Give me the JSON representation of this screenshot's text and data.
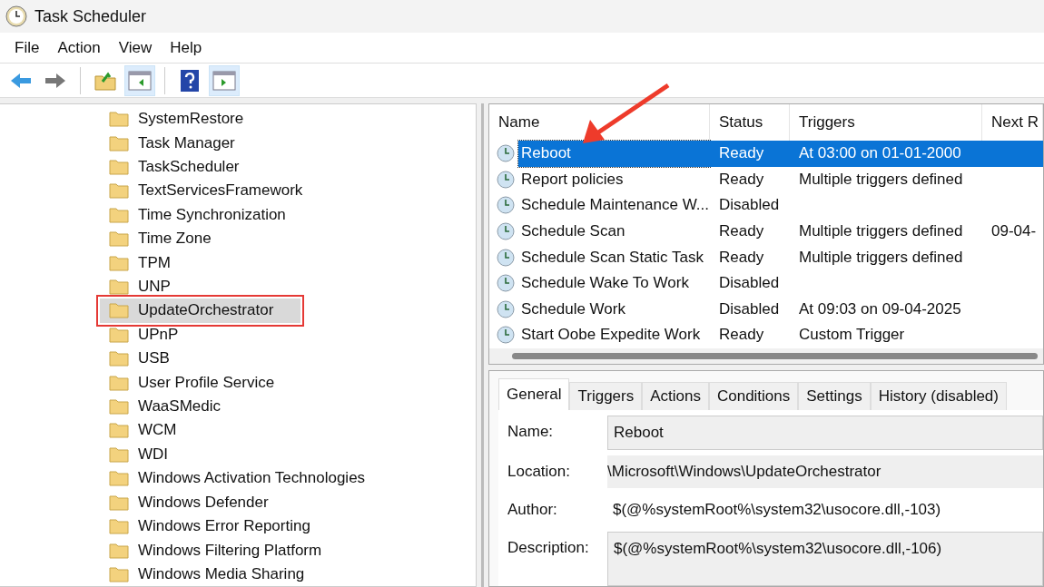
{
  "window": {
    "title": "Task Scheduler"
  },
  "menu": [
    "File",
    "Action",
    "View",
    "Help"
  ],
  "toolbar": [
    {
      "kind": "back",
      "pressed": false
    },
    {
      "kind": "forward",
      "pressed": false
    },
    {
      "kind": "sep"
    },
    {
      "kind": "folder",
      "pressed": false
    },
    {
      "kind": "pane-left",
      "pressed": true
    },
    {
      "kind": "sep"
    },
    {
      "kind": "help",
      "pressed": false
    },
    {
      "kind": "pane-right",
      "pressed": true
    }
  ],
  "tree": [
    {
      "label": "SystemRestore",
      "selected": false,
      "outlined": false
    },
    {
      "label": "Task Manager",
      "selected": false,
      "outlined": false
    },
    {
      "label": "TaskScheduler",
      "selected": false,
      "outlined": false
    },
    {
      "label": "TextServicesFramework",
      "selected": false,
      "outlined": false
    },
    {
      "label": "Time Synchronization",
      "selected": false,
      "outlined": false
    },
    {
      "label": "Time Zone",
      "selected": false,
      "outlined": false
    },
    {
      "label": "TPM",
      "selected": false,
      "outlined": false
    },
    {
      "label": "UNP",
      "selected": false,
      "outlined": false
    },
    {
      "label": "UpdateOrchestrator",
      "selected": true,
      "outlined": true
    },
    {
      "label": "UPnP",
      "selected": false,
      "outlined": false
    },
    {
      "label": "USB",
      "selected": false,
      "outlined": false
    },
    {
      "label": "User Profile Service",
      "selected": false,
      "outlined": false
    },
    {
      "label": "WaaSMedic",
      "selected": false,
      "outlined": false
    },
    {
      "label": "WCM",
      "selected": false,
      "outlined": false
    },
    {
      "label": "WDI",
      "selected": false,
      "outlined": false
    },
    {
      "label": "Windows Activation Technologies",
      "selected": false,
      "outlined": false
    },
    {
      "label": "Windows Defender",
      "selected": false,
      "outlined": false
    },
    {
      "label": "Windows Error Reporting",
      "selected": false,
      "outlined": false
    },
    {
      "label": "Windows Filtering Platform",
      "selected": false,
      "outlined": false
    },
    {
      "label": "Windows Media Sharing",
      "selected": false,
      "outlined": false
    }
  ],
  "table": {
    "columns": [
      "Name",
      "Status",
      "Triggers",
      "Next R"
    ],
    "rows": [
      {
        "name": "Reboot",
        "status": "Ready",
        "triggers": "At 03:00 on 01-01-2000",
        "selected": true
      },
      {
        "name": "Report policies",
        "status": "Ready",
        "triggers": "Multiple triggers defined",
        "selected": false
      },
      {
        "name": "Schedule Maintenance W...",
        "status": "Disabled",
        "selected": false
      },
      {
        "name": "Schedule Scan",
        "status": "Ready",
        "triggers": "Multiple triggers defined",
        "next_run": "09-04-",
        "selected": false
      },
      {
        "name": "Schedule Scan Static Task",
        "status": "Ready",
        "triggers": "Multiple triggers defined",
        "selected": false
      },
      {
        "name": "Schedule Wake To Work",
        "status": "Disabled",
        "selected": false
      },
      {
        "name": "Schedule Work",
        "status": "Disabled",
        "triggers": "At 09:03 on 09-04-2025",
        "selected": false
      },
      {
        "name": "Start Oobe Expedite Work",
        "status": "Ready",
        "triggers": "Custom Trigger",
        "selected": false
      }
    ]
  },
  "details": {
    "tabs": [
      {
        "label": "General",
        "selected": true
      },
      {
        "label": "Triggers",
        "selected": false
      },
      {
        "label": "Actions",
        "selected": false
      },
      {
        "label": "Conditions",
        "selected": false
      },
      {
        "label": "Settings",
        "selected": false
      },
      {
        "label": "History (disabled)",
        "selected": false
      }
    ],
    "fields": [
      {
        "label": "Name:",
        "value": "Reboot",
        "kind": "box"
      },
      {
        "label": "Location:",
        "value": "\\Microsoft\\Windows\\UpdateOrchestrator",
        "kind": "flat"
      },
      {
        "label": "Author:",
        "value": "$(@%systemRoot%\\system32\\usocore.dll,-103)",
        "kind": "plain"
      },
      {
        "label": "Description:",
        "value": "$(@%systemRoot%\\system32\\usocore.dll,-106)",
        "kind": "area"
      }
    ]
  }
}
